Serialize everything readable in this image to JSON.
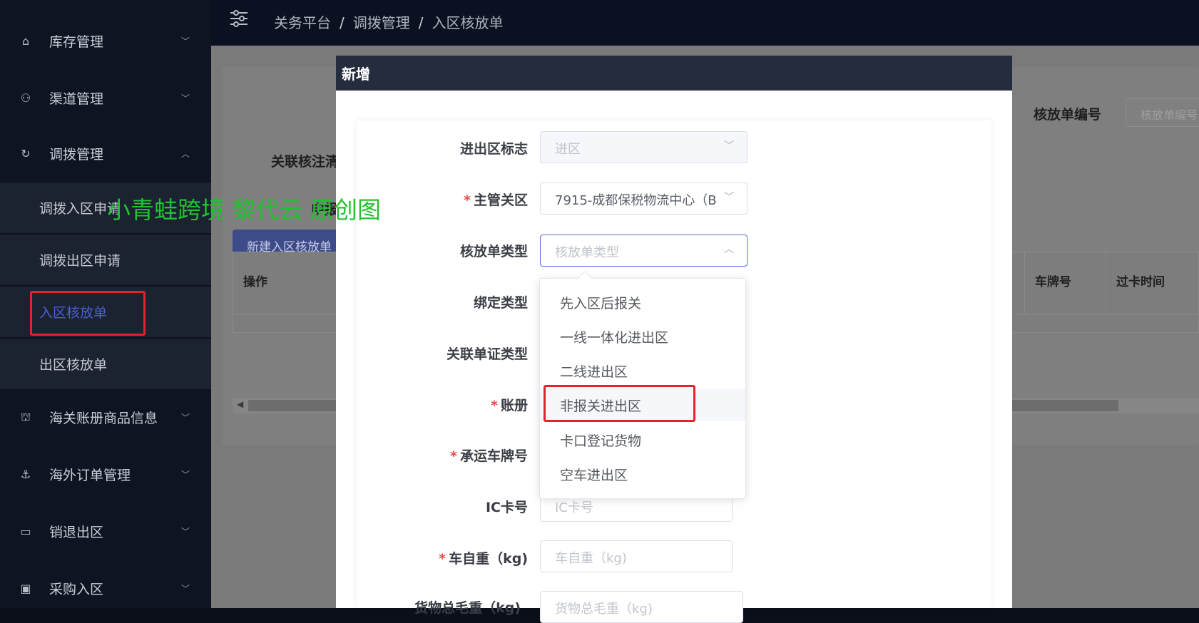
{
  "sidebar": {
    "items": [
      {
        "icon": "home-icon",
        "label": "库存管理",
        "arrow": "chevron-down-icon"
      },
      {
        "icon": "channel-icon",
        "label": "渠道管理",
        "arrow": "chevron-down-icon"
      },
      {
        "icon": "transfer-icon",
        "label": "调拨管理",
        "arrow": "chevron-up-icon"
      },
      {
        "icon": "bag-icon",
        "label": "海关账册商品信息",
        "arrow": "chevron-down-icon"
      },
      {
        "icon": "anchor-icon",
        "label": "海外订单管理",
        "arrow": "chevron-down-icon"
      },
      {
        "icon": "return-icon",
        "label": "销退出区",
        "arrow": "chevron-down-icon"
      },
      {
        "icon": "purchase-icon",
        "label": "采购入区",
        "arrow": "chevron-down-icon"
      }
    ],
    "submenu": [
      "调拨入区申请",
      "调拨出区申请",
      "入区核放单",
      "出区核放单"
    ]
  },
  "header": {
    "breadcrumb": [
      "关务平台",
      "调拨管理",
      "入区核放单"
    ],
    "separator": "/"
  },
  "background": {
    "label_link": "关联核注清",
    "label_apply": "申报",
    "label_number": "核放单编号",
    "number_placeholder": "核放单编号",
    "new_button": "新建入区核放单",
    "columns": [
      "操作",
      "车牌号",
      "过卡时间"
    ]
  },
  "modal": {
    "title": "新增",
    "fields": [
      {
        "label": "进出区标志",
        "required": false,
        "value": "进区"
      },
      {
        "label": "主管关区",
        "required": true,
        "value": "7915-成都保税物流中心（B"
      },
      {
        "label": "核放单类型",
        "required": false,
        "placeholder": "核放单类型"
      },
      {
        "label": "绑定类型",
        "required": false
      },
      {
        "label": "关联单证类型",
        "required": false
      },
      {
        "label": "账册",
        "required": true
      },
      {
        "label": "承运车牌号",
        "required": true
      },
      {
        "label": "IC卡号",
        "required": false,
        "placeholder": "IC卡号"
      },
      {
        "label": "车自重（kg)",
        "required": true,
        "placeholder": "车自重（kg)"
      },
      {
        "label": "货物总毛重（kg)",
        "required": false,
        "placeholder": "货物总毛重（kg)"
      }
    ]
  },
  "dropdown": {
    "options": [
      "先入区后报关",
      "一线一体化进出区",
      "二线进出区",
      "非报关进出区",
      "卡口登记货物",
      "空车进出区"
    ],
    "highlighted": "非报关进出区"
  },
  "watermark": "小青蛙跨境 黎代云 原创图",
  "colors": {
    "highlight_box": "#e3232c",
    "active_menu": "#4b5fd6",
    "watermark": "#22c22f"
  }
}
